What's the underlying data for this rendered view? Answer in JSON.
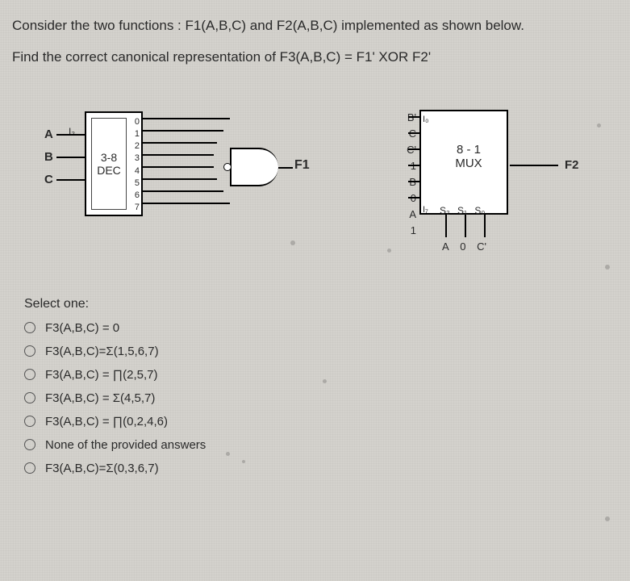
{
  "question": {
    "line1": "Consider the two functions : F1(A,B,C) and F2(A,B,C) implemented as shown below.",
    "line2": "Find the correct canonical representation of F3(A,B,C) = F1' XOR F2'"
  },
  "decoder": {
    "title1": "3-8",
    "title2": "DEC",
    "inputs": [
      "A",
      "B",
      "C"
    ],
    "i_label": "I₂",
    "outputs": [
      "0",
      "1",
      "2",
      "3",
      "4",
      "5",
      "6",
      "7"
    ]
  },
  "gate": {
    "output_label": "F1"
  },
  "mux": {
    "title1": "8 - 1",
    "title2": "MUX",
    "left_values": [
      "B'",
      "C",
      "C'",
      "1",
      "B",
      "0",
      "A",
      "1"
    ],
    "io_top": "I₀",
    "io_bot": "I₇",
    "sel_labels": [
      "S₂",
      "S₁",
      "S₀"
    ],
    "sel_inputs": [
      "A",
      "0",
      "C'"
    ],
    "output_label": "F2"
  },
  "answers": {
    "prompt": "Select one:",
    "options": [
      "F3(A,B,C) = 0",
      "F3(A,B,C)=Σ(1,5,6,7)",
      "F3(A,B,C) = ∏(2,5,7)",
      "F3(A,B,C) = Σ(4,5,7)",
      "F3(A,B,C) = ∏(0,2,4,6)",
      "None of the provided answers",
      "F3(A,B,C)=Σ(0,3,6,7)"
    ]
  }
}
